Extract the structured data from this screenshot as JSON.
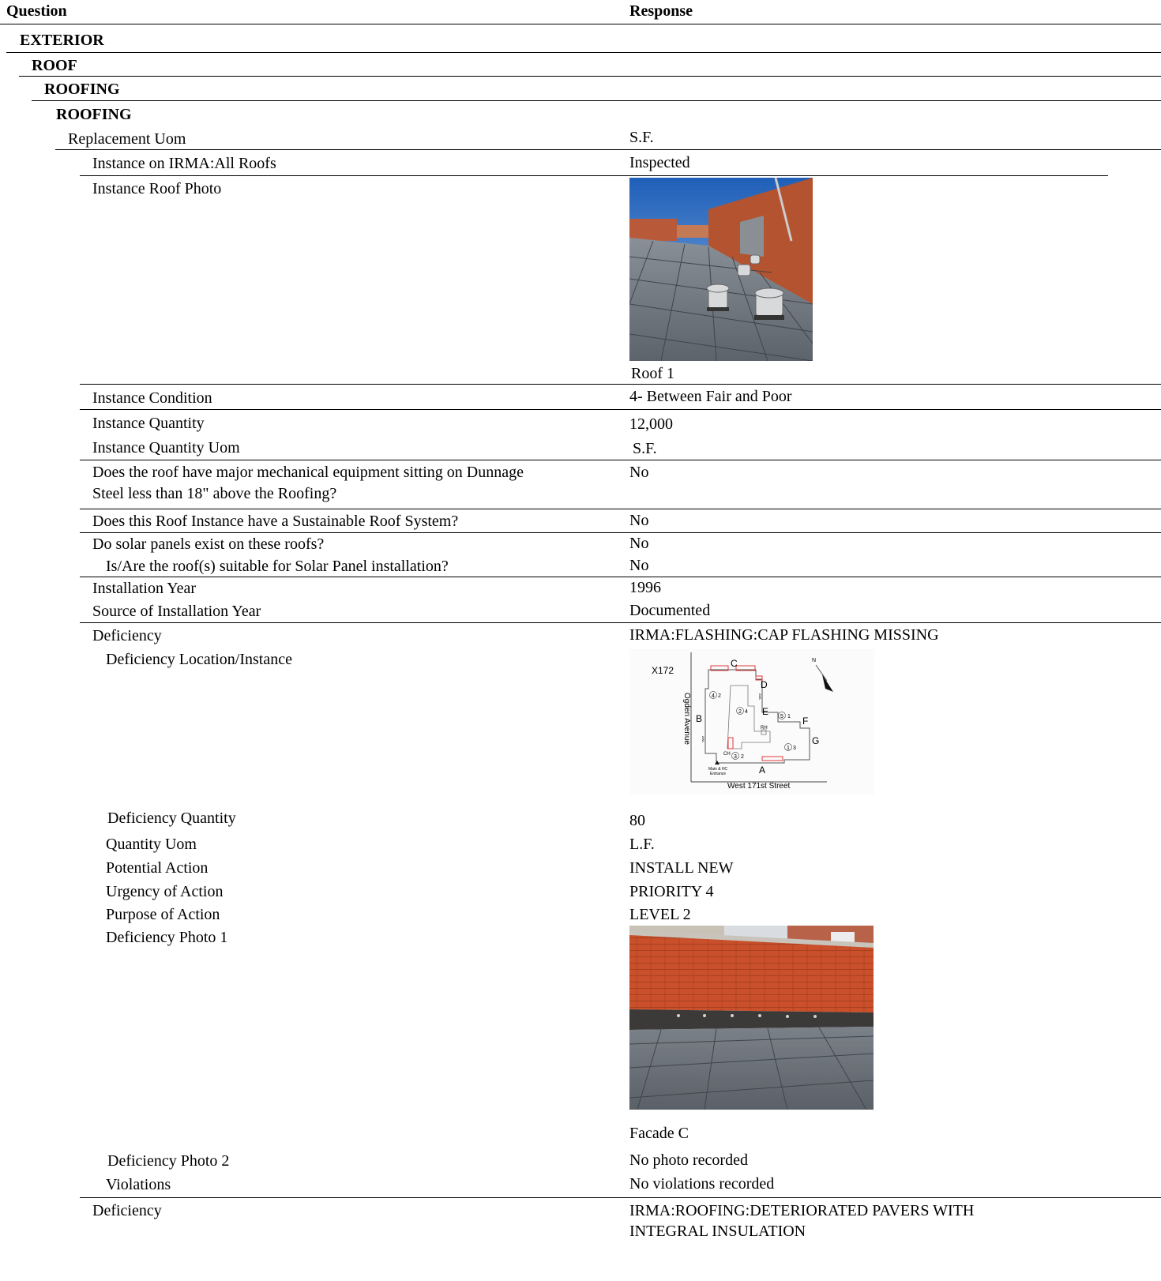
{
  "header": {
    "question": "Question",
    "response": "Response"
  },
  "sections": {
    "exterior": "EXTERIOR",
    "roof": "ROOF",
    "roofing_1": "ROOFING",
    "roofing_2": "ROOFING"
  },
  "rows": {
    "replacement_uom": {
      "q": "Replacement Uom",
      "a": "S.F."
    },
    "instance_on_irma": {
      "q": "Instance on IRMA:All Roofs",
      "a": "Inspected"
    },
    "instance_roof_photo": {
      "q": "Instance Roof Photo",
      "caption": "Roof 1"
    },
    "instance_condition": {
      "q": "Instance Condition",
      "a": "4- Between Fair and Poor"
    },
    "instance_quantity": {
      "q": "Instance Quantity",
      "a": "12,000"
    },
    "instance_quantity_uom": {
      "q": "Instance Quantity Uom",
      "a": "S.F."
    },
    "dunnage": {
      "q1": "Does the roof have major mechanical equipment sitting on Dunnage",
      "q2": "Steel less than 18\" above the Roofing?",
      "a": "No"
    },
    "sustainable": {
      "q": "Does this Roof Instance have a Sustainable Roof System?",
      "a": "No"
    },
    "solar_exist": {
      "q": "Do solar panels exist on these roofs?",
      "a": "No"
    },
    "solar_suitable": {
      "q": "Is/Are the roof(s) suitable for Solar Panel installation?",
      "a": "No"
    },
    "installation_year": {
      "q": "Installation Year",
      "a": "1996"
    },
    "source_year": {
      "q": "Source of Installation Year",
      "a": "Documented"
    },
    "deficiency_1": {
      "q": "Deficiency",
      "a": "IRMA:FLASHING:CAP FLASHING MISSING"
    },
    "deficiency_location": {
      "q": "Deficiency Location/Instance"
    },
    "deficiency_quantity": {
      "q": "Deficiency Quantity",
      "a": "80"
    },
    "quantity_uom": {
      "q": "Quantity Uom",
      "a": "L.F."
    },
    "potential_action": {
      "q": "Potential Action",
      "a": "INSTALL NEW"
    },
    "urgency": {
      "q": "Urgency of Action",
      "a": "PRIORITY 4"
    },
    "purpose": {
      "q": "Purpose of Action",
      "a": "LEVEL 2"
    },
    "deficiency_photo_1": {
      "q": "Deficiency Photo 1",
      "caption": "Facade C"
    },
    "deficiency_photo_2": {
      "q": "Deficiency Photo 2",
      "a": "No photo recorded"
    },
    "violations": {
      "q": "Violations",
      "a": "No violations recorded"
    },
    "deficiency_2": {
      "q": "Deficiency",
      "a1": "IRMA:ROOFING:DETERIORATED PAVERS WITH",
      "a2": "INTEGRAL INSULATION"
    }
  },
  "site_plan": {
    "building_id": "X172",
    "north": "N",
    "street_left": "Ogden Avenue",
    "street_bottom": "West 171st Street",
    "entrance_1": "Main & HC",
    "entrance_2": "Entrance",
    "rh": "RH",
    "ch": "CH",
    "awl": "AWL",
    "labels": {
      "a": "A",
      "b": "B",
      "c": "C",
      "d": "D",
      "e": "E",
      "f": "F",
      "g": "G"
    },
    "roof_marks": {
      "m1": "4",
      "m1b": "2",
      "m2": "2",
      "m2b": "4",
      "m3": "5",
      "m3b": "1",
      "m4": "1",
      "m4b": "3",
      "m5": "3",
      "m5b": "2"
    },
    "flashing_color": "#e03a3a"
  }
}
